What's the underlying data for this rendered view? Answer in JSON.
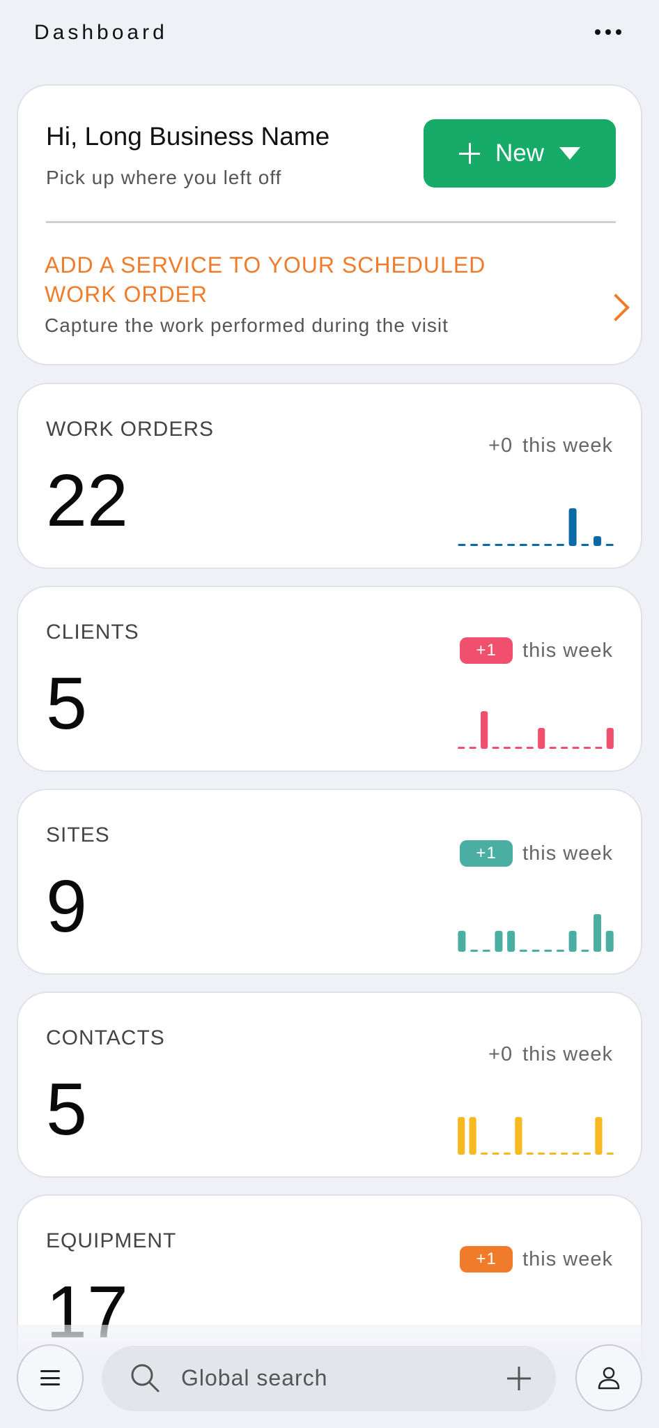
{
  "header": {
    "title": "Dashboard",
    "more_icon": "more-horizontal-icon"
  },
  "welcome": {
    "greeting": "Hi, Long Business Name",
    "subtitle": "Pick up where you left off",
    "new_button": {
      "label": "New",
      "icon_left": "plus-icon",
      "icon_right": "caret-down-icon"
    }
  },
  "promo": {
    "title": "ADD A SERVICE TO YOUR SCHEDULED WORK ORDER",
    "description": "Capture the work performed during the visit",
    "icon": "chevron-right-icon"
  },
  "colors": {
    "accent_green": "#17ab6a",
    "promo_orange": "#f07c2b",
    "work_orders": "#0a6aa8",
    "clients": "#f0506e",
    "sites": "#4aafa2",
    "contacts": "#f6b922",
    "equipment": "#f07c2b"
  },
  "week_suffix": "this week",
  "stats": [
    {
      "id": "work_orders",
      "label": "WORK ORDERS",
      "value": "22",
      "delta": "+0",
      "delta_badge": false,
      "color": "#0a6aa8",
      "bars": [
        0,
        0,
        0,
        0,
        0,
        0,
        0,
        0,
        0,
        6,
        0,
        1,
        0
      ]
    },
    {
      "id": "clients",
      "label": "CLIENTS",
      "value": "5",
      "delta": "+1",
      "delta_badge": true,
      "color": "#f0506e",
      "bars": [
        0,
        0,
        4,
        0,
        0,
        0,
        0,
        2,
        0,
        0,
        0,
        0,
        0,
        2
      ]
    },
    {
      "id": "sites",
      "label": "SITES",
      "value": "9",
      "delta": "+1",
      "delta_badge": true,
      "color": "#4aafa2",
      "bars": [
        2,
        0,
        0,
        2,
        2,
        0,
        0,
        0,
        0,
        2,
        0,
        4,
        2
      ]
    },
    {
      "id": "contacts",
      "label": "CONTACTS",
      "value": "5",
      "delta": "+0",
      "delta_badge": false,
      "color": "#f6b922",
      "bars": [
        4,
        4,
        0,
        0,
        0,
        4,
        0,
        0,
        0,
        0,
        0,
        0,
        4,
        0
      ]
    },
    {
      "id": "equipment",
      "label": "EQUIPMENT",
      "value": "17",
      "delta": "+1",
      "delta_badge": true,
      "color": "#f07c2b",
      "bars": []
    }
  ],
  "bottom_bar": {
    "menu_icon": "hamburger-menu-icon",
    "search_icon": "search-icon",
    "search_placeholder": "Global search",
    "add_icon": "plus-icon",
    "profile_icon": "user-profile-icon"
  }
}
